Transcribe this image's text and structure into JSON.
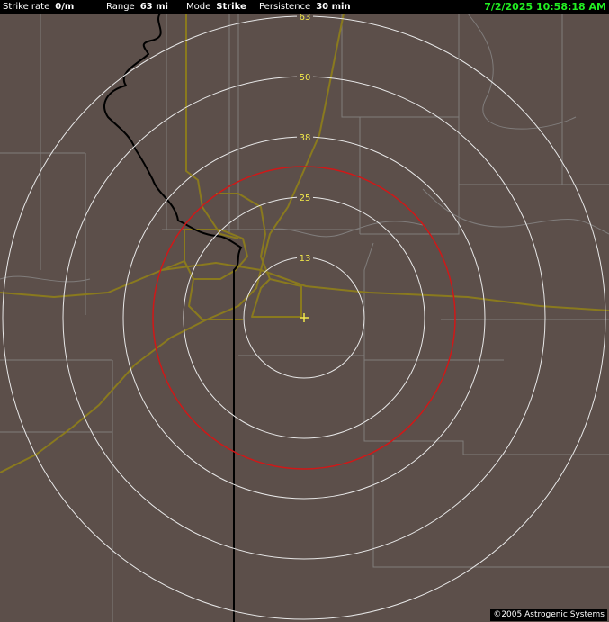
{
  "status": {
    "strike_rate_label": "Strike rate",
    "strike_rate_value": "0/m",
    "range_label": "Range",
    "range_value": "63 mi",
    "mode_label": "Mode",
    "mode_value": "Strike",
    "persistence_label": "Persistence",
    "persistence_value": "30 min",
    "timestamp": "7/2/2025 10:58:18 AM"
  },
  "range_rings": {
    "labels": [
      "13",
      "25",
      "38",
      "50",
      "63"
    ],
    "units": "mi"
  },
  "alert_ring_color": "#d01818",
  "ring_color": "#e8e8e8",
  "highway_color": "#8a7a1e",
  "center_marker": "plus-icon",
  "copyright": "©2005 Astrogenic Systems"
}
